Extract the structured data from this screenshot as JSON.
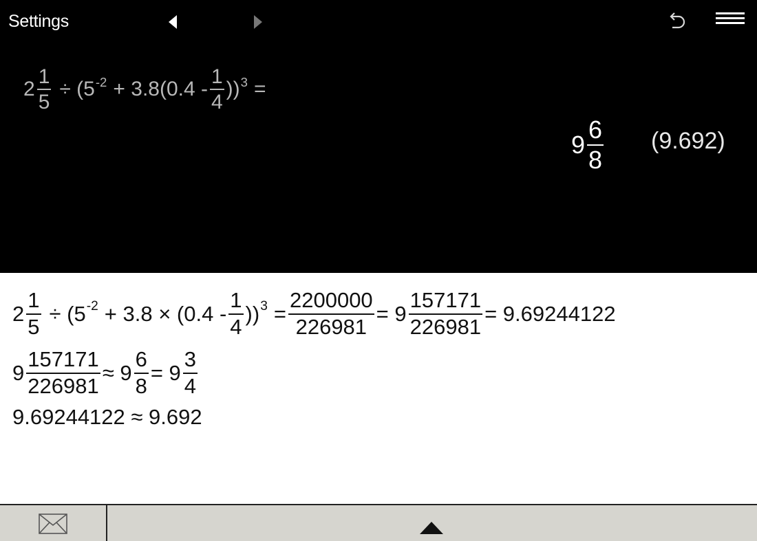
{
  "topbar": {
    "settings_label": "Settings",
    "icons": {
      "prev": "triangle-left-icon",
      "next": "triangle-right-icon",
      "undo": "undo-icon",
      "menu": "hamburger-menu-icon"
    }
  },
  "display": {
    "expression": {
      "whole": "2",
      "f1_num": "1",
      "f1_den": "5",
      "part1": "÷ (5",
      "exp1": "-2",
      "part2": "+ 3.8(0.4 -",
      "f2_num": "1",
      "f2_den": "4",
      "part3": "))",
      "exp2": "3",
      "equals": "="
    },
    "result": {
      "whole": "9",
      "num": "6",
      "den": "8"
    },
    "decimal": "(9.692)"
  },
  "history": {
    "line1": {
      "whole": "2",
      "f1_num": "1",
      "f1_den": "5",
      "part1": "÷ (5",
      "exp1": "-2",
      "part2": "+ 3.8 × (0.4 -",
      "f2_num": "1",
      "f2_den": "4",
      "part3": "))",
      "exp2": "3",
      "eq1": "=",
      "f3_num": "2200000",
      "f3_den": "226981",
      "eq2": "= 9",
      "f4_num": "157171",
      "f4_den": "226981",
      "eq3": "= 9.69244122"
    },
    "line2": {
      "whole1": "9",
      "f1_num": "157171",
      "f1_den": "226981",
      "approx": "≈ 9",
      "f2_num": "6",
      "f2_den": "8",
      "eq": "= 9",
      "f3_num": "3",
      "f3_den": "4"
    },
    "line3": {
      "text": "9.69244122 ≈ 9.692"
    }
  },
  "bottombar": {
    "icons": {
      "mail": "envelope-icon",
      "expand": "triangle-up-icon"
    }
  }
}
